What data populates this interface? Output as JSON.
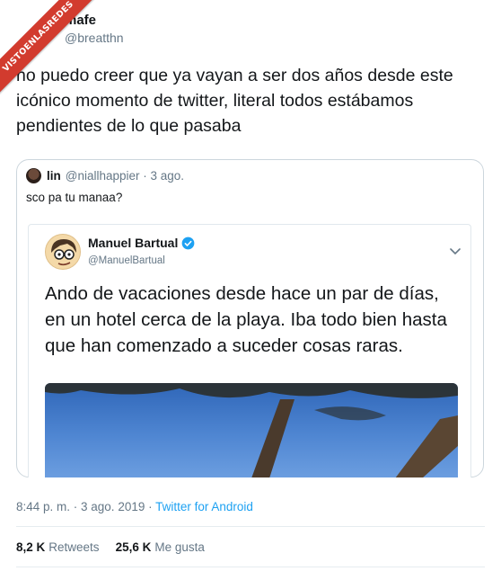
{
  "watermark": "VISTOENLASREDES",
  "author": {
    "name": "mafe",
    "handle": "@breatthn"
  },
  "tweet_text": "no puedo creer que ya vayan a ser dos años desde este icónico momento de twitter, literal todos estábamos pendientes de lo que pasaba",
  "quote": {
    "name": "lin",
    "meta": "@niallhappier · 3 ago.",
    "text": "sco pa tu manaa?",
    "embedded": {
      "name": "Manuel Bartual",
      "handle": "@ManuelBartual",
      "text": "Ando de vacaciones desde hace un par de días, en un hotel cerca de la playa. Iba todo bien hasta que han comenzado a suceder cosas raras."
    }
  },
  "timestamp": "8:44 p. m. · 3 ago. 2019 · ",
  "source": "Twitter for Android",
  "stats": {
    "retweets_count": "8,2 K",
    "retweets_label": "Retweets",
    "likes_count": "25,6 K",
    "likes_label": "Me gusta"
  },
  "colors": {
    "accent": "#1da1f2",
    "secondary_text": "#657786",
    "watermark": "#d23b2e"
  },
  "icons": [
    "verified-badge-icon",
    "chevron-down-icon",
    "avatar-cartoon-icon"
  ]
}
